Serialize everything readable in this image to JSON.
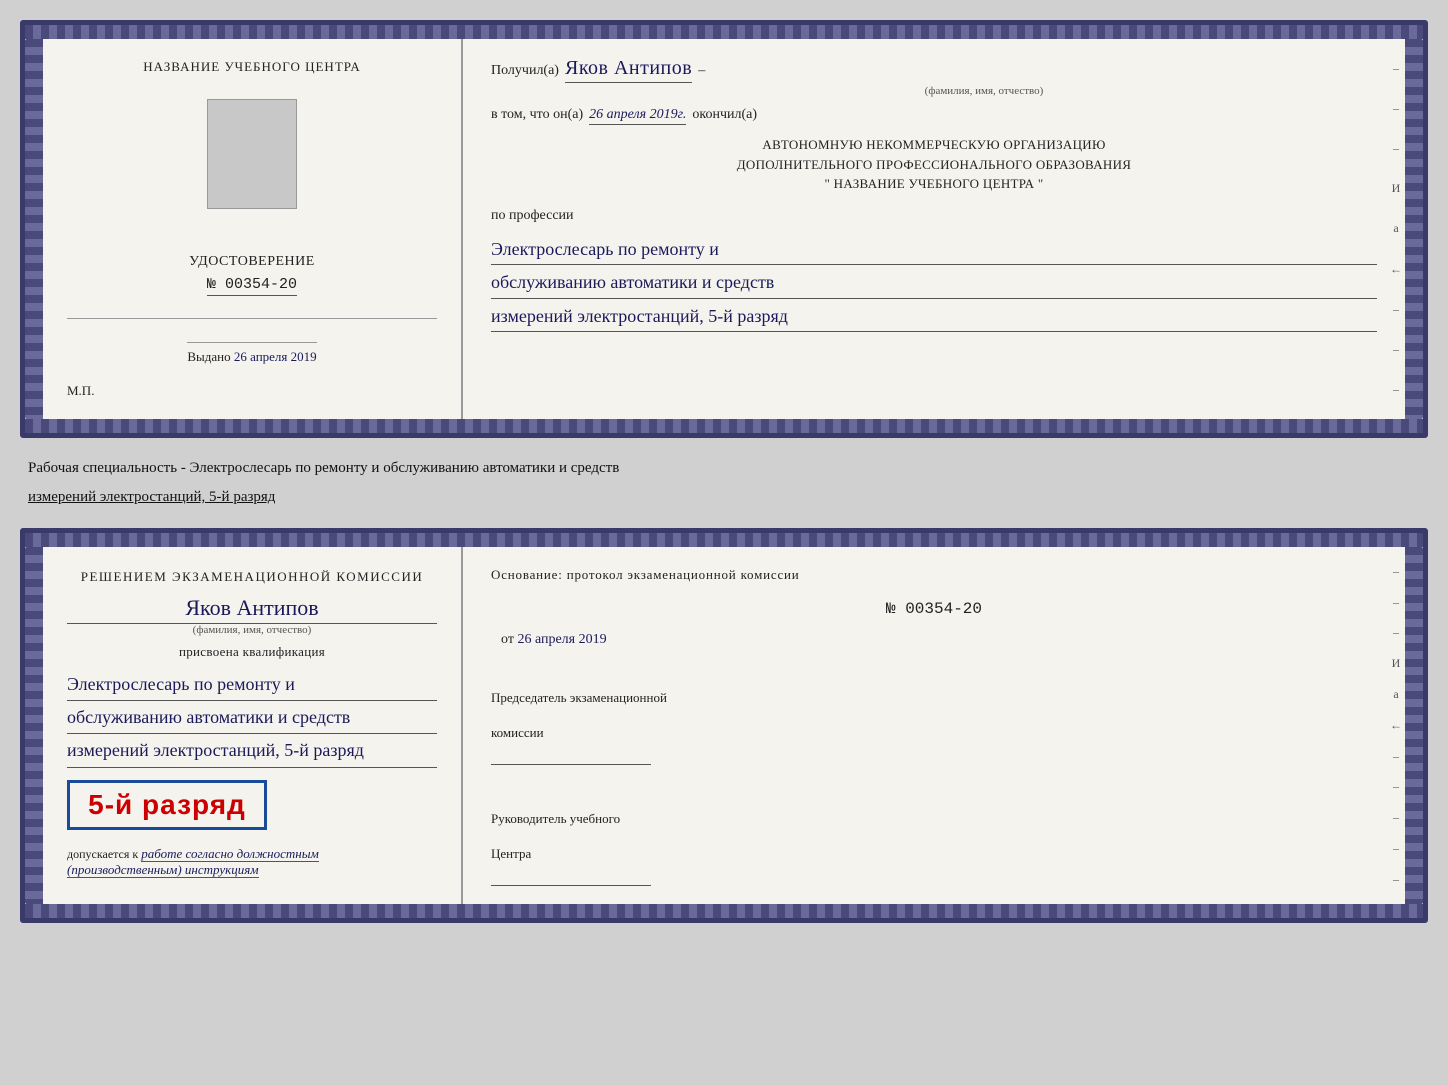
{
  "top_card": {
    "left": {
      "center_label": "НАЗВАНИЕ УЧЕБНОГО ЦЕНТРА",
      "udostoverenie_title": "УДОСТОВЕРЕНИЕ",
      "number": "№ 00354-20",
      "vydano_label": "Выдано",
      "vydano_date": "26 апреля 2019",
      "mp_label": "М.П."
    },
    "right": {
      "poluchil_label": "Получил(а)",
      "poluchil_name": "Яков Антипов",
      "fio_hint": "(фамилия, имя, отчество)",
      "vtom_label": "в том, что он(а)",
      "date_handwritten": "26 апреля 2019г.",
      "okonchil_label": "окончил(а)",
      "org_line1": "АВТОНОМНУЮ НЕКОММЕРЧЕСКУЮ ОРГАНИЗАЦИЮ",
      "org_line2": "ДОПОЛНИТЕЛЬНОГО ПРОФЕССИОНАЛЬНОГО ОБРАЗОВАНИЯ",
      "org_name": "\" НАЗВАНИЕ УЧЕБНОГО ЦЕНТРА \"",
      "poprofessii_label": "по профессии",
      "profession_line1": "Электрослесарь по ремонту и",
      "profession_line2": "обслуживанию автоматики и средств",
      "profession_line3": "измерений электростанций, 5-й разряд"
    }
  },
  "description": {
    "text_line1": "Рабочая специальность - Электрослесарь по ремонту и обслуживанию автоматики и средств",
    "text_line2": "измерений электростанций, 5-й разряд"
  },
  "bottom_card": {
    "left": {
      "resheniem_text": "Решением экзаменационной комиссии",
      "name_handwritten": "Яков Антипов",
      "fio_hint": "(фамилия, имя, отчество)",
      "prisvoena_label": "присвоена квалификация",
      "qual_line1": "Электрослесарь по ремонту и",
      "qual_line2": "обслуживанию автоматики и средств",
      "qual_line3": "измерений электростанций, 5-й разряд",
      "razryad_text": "5-й разряд",
      "dopuskaetsya_label": "допускается к",
      "dopuskaetsya_text": "работе согласно должностным",
      "dopuskaetsya_text2": "(производственным) инструкциям"
    },
    "right": {
      "osnov_label": "Основание: протокол экзаменационной комиссии",
      "protocol_number": "№ 00354-20",
      "ot_label": "от",
      "ot_date": "26 апреля 2019",
      "predsedatel_label": "Председатель экзаменационной",
      "predsedatel_label2": "комиссии",
      "rukovoditel_label": "Руководитель учебного",
      "rukovoditel_label2": "Центра"
    }
  },
  "side_dashes": [
    "-",
    "-",
    "-",
    "и",
    "а",
    "←",
    "-",
    "-",
    "-",
    "-",
    "-"
  ],
  "bottom_side_dashes": [
    "-",
    "-",
    "-",
    "и",
    "а",
    "←",
    "-",
    "-",
    "-",
    "-",
    "-"
  ]
}
